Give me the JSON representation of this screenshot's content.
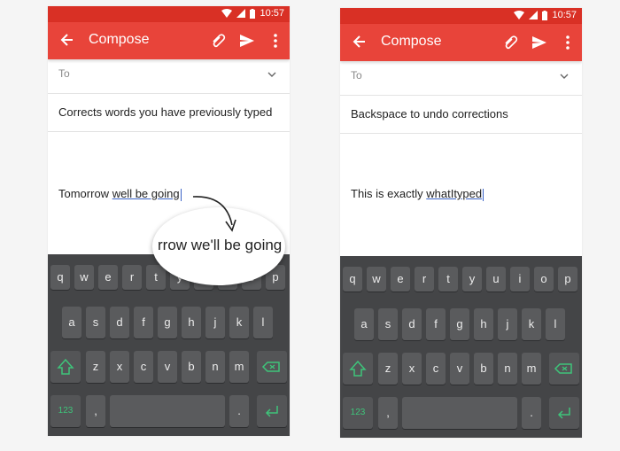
{
  "colors": {
    "statusbar": "#d93025",
    "appbar": "#e8443a",
    "keyboard": "#444547",
    "key": "#5a5b5d",
    "accent": "#3ec47a",
    "underline": "#3a63c7"
  },
  "left": {
    "status": {
      "time": "10:57"
    },
    "appbar": {
      "title": "Compose"
    },
    "to_label": "To",
    "subject": "Corrects words you have previously typed",
    "body": {
      "prefix": "Tomorrow ",
      "underlined": "well be going"
    },
    "magnifier": {
      "text": "rrow we'll be going"
    }
  },
  "right": {
    "status": {
      "time": "10:57"
    },
    "appbar": {
      "title": "Compose"
    },
    "to_label": "To",
    "subject": "Backspace to undo corrections",
    "body": {
      "prefix": "This is exactly ",
      "underlined": "whatItyped"
    }
  },
  "keyboard": {
    "row1": [
      "q",
      "w",
      "e",
      "r",
      "t",
      "y",
      "u",
      "i",
      "o",
      "p"
    ],
    "row2": [
      "a",
      "s",
      "d",
      "f",
      "g",
      "h",
      "j",
      "k",
      "l"
    ],
    "row3": [
      "z",
      "x",
      "c",
      "v",
      "b",
      "n",
      "m"
    ],
    "symbols_label": "123",
    "comma": ",",
    "period": "."
  }
}
